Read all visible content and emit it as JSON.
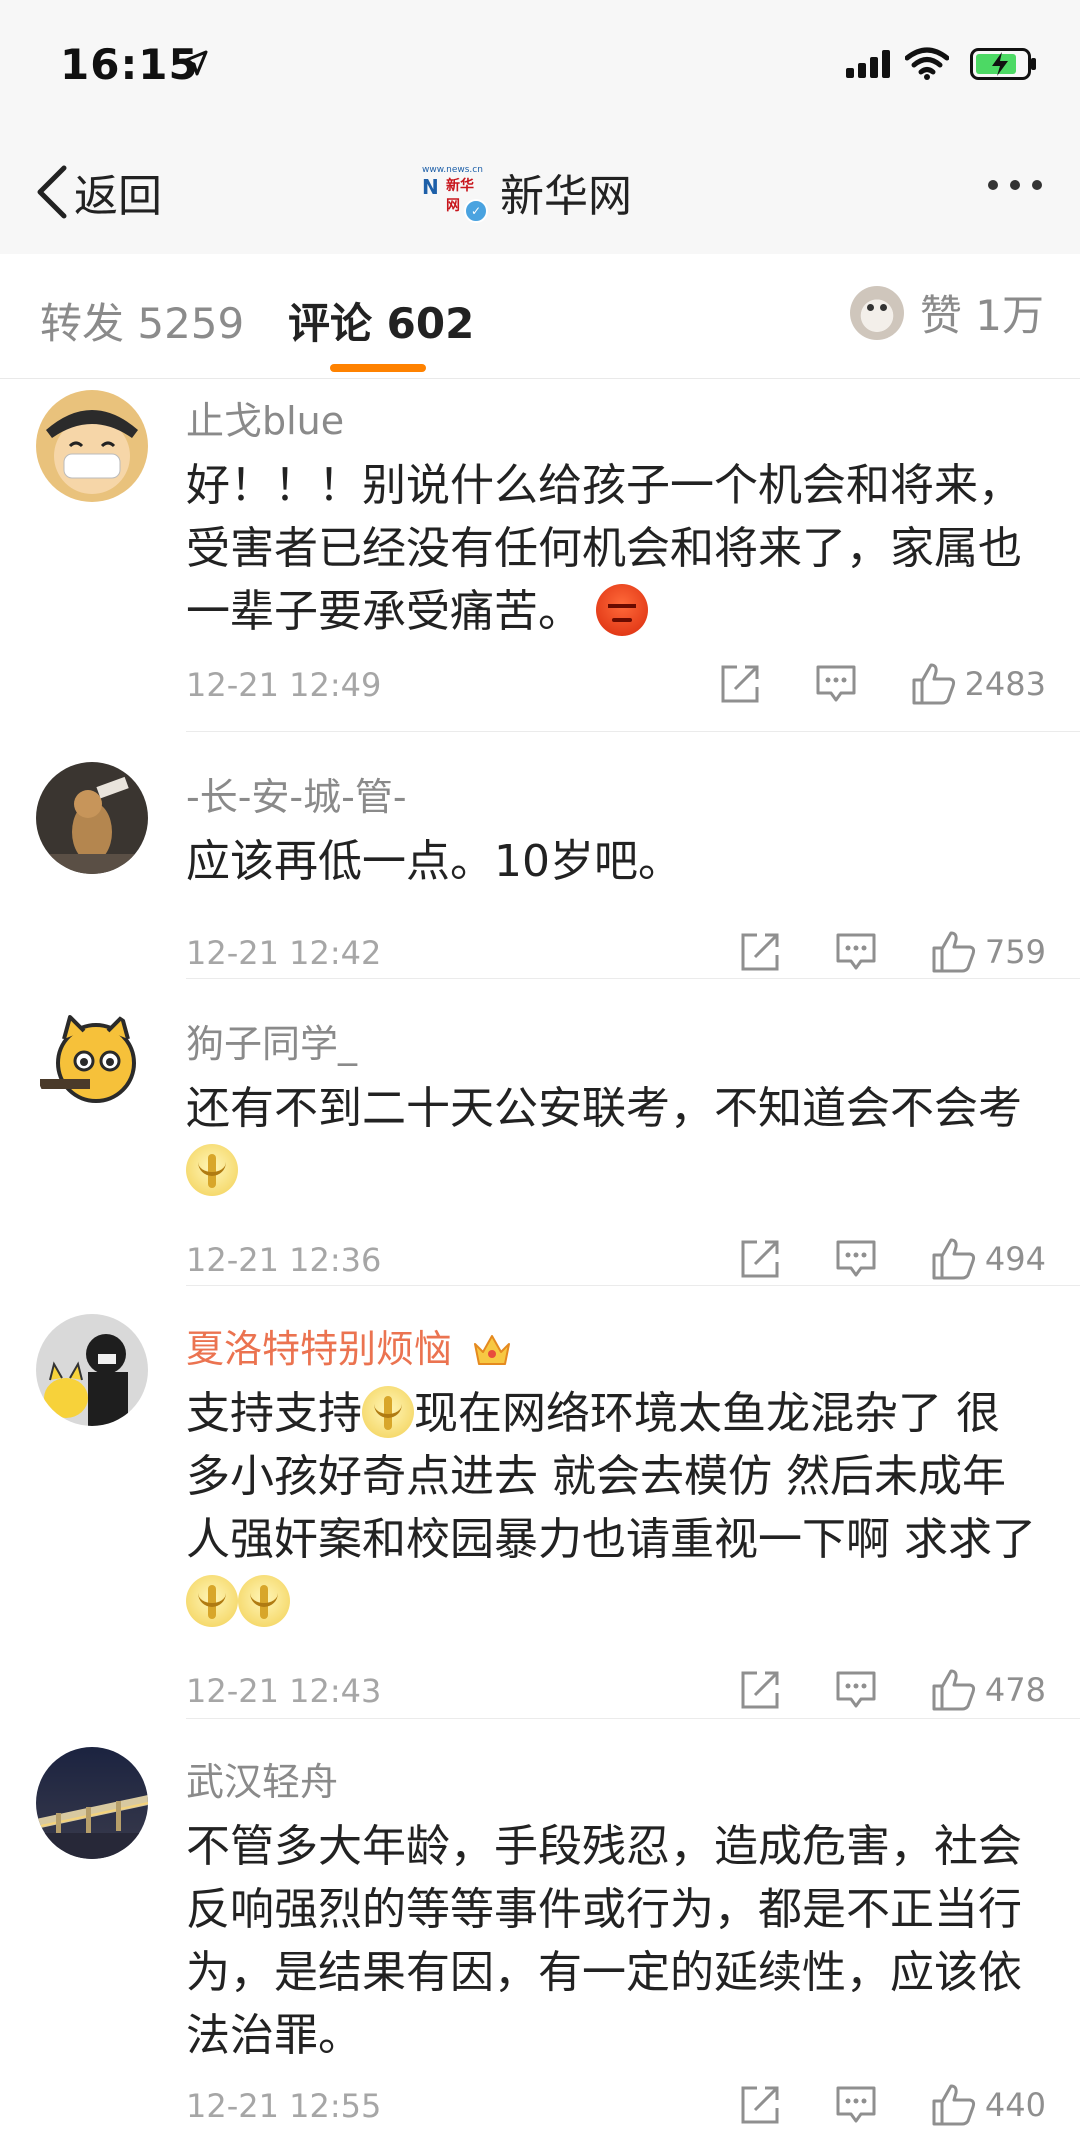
{
  "status_bar": {
    "time": "16:15",
    "icons": [
      "location-arrow-icon",
      "signal-icon",
      "wifi-icon",
      "battery-charging-icon"
    ]
  },
  "nav": {
    "back_label": "返回",
    "title": "新华网",
    "logo_text_small": "www.news.cn",
    "logo_text_big": "N",
    "logo_text_cn": "新华网",
    "more_icon": "more-dots-icon"
  },
  "tabs": {
    "repost": "转发 5259",
    "comments": "评论 602",
    "likes": "赞 1万",
    "accent_color": "#ff8200"
  },
  "comments": [
    {
      "user": "止戈blue",
      "vip": false,
      "text_parts": [
        "好！！！别说什么给孩子一个机会和将来，受害者已经没有任何机会和将来了，家属也一辈子要承受痛苦。"
      ],
      "emojis": [
        "angry-emoji"
      ],
      "time": "12-21 12:49",
      "likes": "2483"
    },
    {
      "user": "-长-安-城-管-",
      "vip": false,
      "text_parts": [
        "应该再低一点。10岁吧。"
      ],
      "emojis": [],
      "time": "12-21 12:42",
      "likes": "759"
    },
    {
      "user": "狗子同学_",
      "vip": false,
      "text_parts": [
        "还有不到二十天公安联考，不知道会不会考"
      ],
      "emojis": [
        "pray-emoji"
      ],
      "time": "12-21 12:36",
      "likes": "494"
    },
    {
      "user": "夏洛特特别烦恼",
      "vip": true,
      "text_parts": [
        "支持支持",
        "现在网络环境太鱼龙混杂了 很多小孩好奇点进去 就会去模仿 然后未成年人强奸案和校园暴力也请重视一下啊 求求了"
      ],
      "emojis": [
        "pray-emoji",
        "pray-emoji",
        "pray-emoji"
      ],
      "time": "12-21 12:43",
      "likes": "478"
    },
    {
      "user": "武汉轻舟",
      "vip": false,
      "text_parts": [
        "不管多大年龄，手段残忍，造成危害，社会反响强烈的等等事件或行为，都是不正当行为，是结果有因，有一定的延续性，应该依法治罪。"
      ],
      "emojis": [],
      "time": "12-21 12:55",
      "likes": "440"
    }
  ],
  "colors": {
    "vip_name": "#eb7350",
    "username": "#8a8a8a",
    "meta": "#a6a6a6"
  }
}
